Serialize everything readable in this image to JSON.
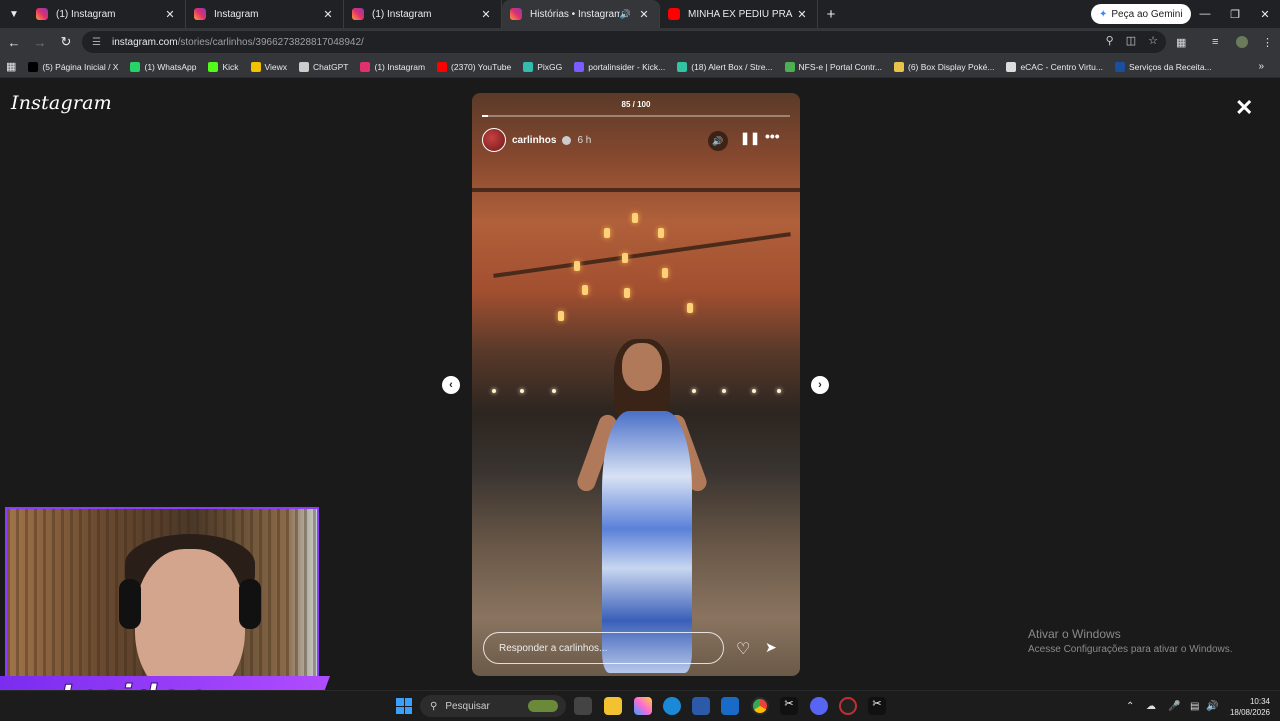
{
  "browser": {
    "tabs": [
      {
        "title": "(1) Instagram",
        "icon": "instagram-icon",
        "active": false
      },
      {
        "title": "Instagram",
        "icon": "instagram-icon",
        "active": false
      },
      {
        "title": "(1) Instagram",
        "icon": "instagram-icon",
        "active": false
      },
      {
        "title": "Histórias • Instagram",
        "icon": "instagram-icon",
        "active": true
      },
      {
        "title": "MINHA EX PEDIU PRA DORMIR",
        "icon": "youtube-icon",
        "active": false
      }
    ],
    "gemini_label": "Peça ao Gemini",
    "url_host": "instagram.com",
    "url_path": "/stories/carlinhos/3966273828817048942/",
    "bookmarks": [
      {
        "label": "(5) Página Inicial / X",
        "icon": "x-icon",
        "color": "#000000"
      },
      {
        "label": "(1) WhatsApp",
        "icon": "whatsapp-icon",
        "color": "#25d366"
      },
      {
        "label": "Kick",
        "icon": "kick-icon",
        "color": "#53fc18"
      },
      {
        "label": "Viewx",
        "icon": "viewx-icon",
        "color": "#f2c200"
      },
      {
        "label": "ChatGPT",
        "icon": "chatgpt-icon",
        "color": "#cccccc"
      },
      {
        "label": "(1) Instagram",
        "icon": "instagram-icon",
        "color": "#e1306c"
      },
      {
        "label": "(2370) YouTube",
        "icon": "youtube-icon",
        "color": "#ff0000"
      },
      {
        "label": "PixGG",
        "icon": "pixgg-icon",
        "color": "#32bcad"
      },
      {
        "label": "portalinsider - Kick...",
        "icon": "portal-icon",
        "color": "#7a5cff"
      },
      {
        "label": "(18) Alert Box / Stre...",
        "icon": "alertbox-icon",
        "color": "#31c3a2"
      },
      {
        "label": "NFS-e | Portal Contr...",
        "icon": "nfse-icon",
        "color": "#4caf50"
      },
      {
        "label": "(6) Box Display Poké...",
        "icon": "pokemon-icon",
        "color": "#e8c24a"
      },
      {
        "label": "eCAC - Centro Virtu...",
        "icon": "ecac-icon",
        "color": "#dddddd"
      },
      {
        "label": "Serviços da Receita...",
        "icon": "receita-icon",
        "color": "#1a4fa0"
      }
    ]
  },
  "instagram": {
    "logo": "Instagram",
    "story": {
      "counter": "85 / 100",
      "progress": 0.02,
      "username": "carlinhos",
      "time": "6 h",
      "reply_placeholder": "Responder a carlinhos..."
    }
  },
  "windows": {
    "watermark_title": "Ativar o Windows",
    "watermark_sub": "Acesse Configurações para ativar o Windows.",
    "search_label": "Pesquisar",
    "clock_time": "10:34",
    "clock_date": "18/08/2026"
  },
  "overlay": {
    "brand_text": "Insider"
  }
}
